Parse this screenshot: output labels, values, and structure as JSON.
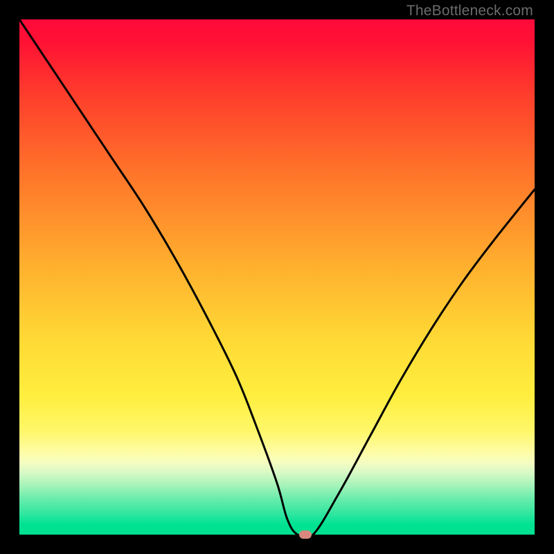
{
  "watermark": "TheBottleneck.com",
  "chart_data": {
    "type": "line",
    "title": "",
    "xlabel": "",
    "ylabel": "",
    "xlim": [
      0,
      100
    ],
    "ylim": [
      0,
      100
    ],
    "grid": false,
    "legend": false,
    "series": [
      {
        "name": "bottleneck-curve",
        "x": [
          0,
          6,
          12,
          18,
          24,
          30,
          36,
          42,
          46,
          50,
          52,
          54,
          57,
          62,
          68,
          74,
          80,
          86,
          92,
          100
        ],
        "values": [
          100,
          91,
          82,
          73,
          64,
          54,
          43,
          31,
          21,
          10,
          3,
          0,
          0,
          8,
          19,
          30,
          40,
          49,
          57,
          67
        ]
      }
    ],
    "annotations": [
      {
        "name": "optimal-marker",
        "x": 55.5,
        "y": 0
      }
    ],
    "background_gradient": {
      "direction": "vertical",
      "stops": [
        {
          "pos": 0,
          "color": "#ff0a3a"
        },
        {
          "pos": 0.3,
          "color": "#ff752a"
        },
        {
          "pos": 0.62,
          "color": "#ffd935"
        },
        {
          "pos": 0.84,
          "color": "#fdfca6"
        },
        {
          "pos": 1.0,
          "color": "#00e090"
        }
      ]
    }
  }
}
